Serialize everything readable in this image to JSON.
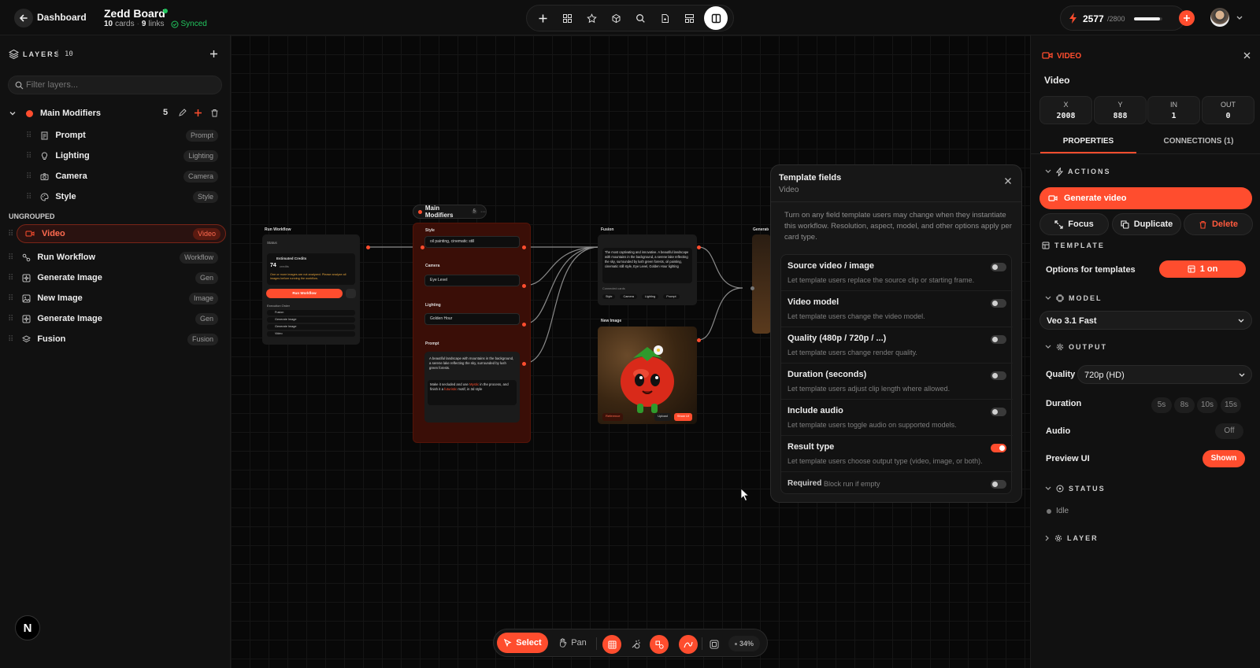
{
  "topbar": {
    "back_label": "Dashboard",
    "board_title": "Zedd Board",
    "cards_count": "10",
    "cards_label": "cards",
    "links_count": "9",
    "links_label": "links",
    "synced_label": "Synced",
    "credits_value": "2577",
    "credits_total": "/2800",
    "credits_fraction": 0.92
  },
  "layers": {
    "title": "LAYERS",
    "count": "10",
    "filter_placeholder": "Filter layers...",
    "group": {
      "name": "Main Modifiers",
      "count": "5"
    },
    "group_items": [
      {
        "label": "Prompt",
        "tag": "Prompt"
      },
      {
        "label": "Lighting",
        "tag": "Lighting"
      },
      {
        "label": "Camera",
        "tag": "Camera"
      },
      {
        "label": "Style",
        "tag": "Style"
      }
    ],
    "ungrouped_label": "UNGROUPED",
    "ungrouped_items": [
      {
        "label": "Video",
        "tag": "Video"
      },
      {
        "label": "Run Workflow",
        "tag": "Workflow"
      },
      {
        "label": "Generate Image",
        "tag": "Gen"
      },
      {
        "label": "New Image",
        "tag": "Image"
      },
      {
        "label": "Generate Image",
        "tag": "Gen"
      },
      {
        "label": "Fusion",
        "tag": "Fusion"
      }
    ]
  },
  "canvas": {
    "group_label": "Main Modifiers",
    "group_count": "5",
    "run_node": {
      "title": "Run Workflow",
      "status_label": "Status",
      "credits_label": "Estimated Credits",
      "credits_value": "74",
      "credits_unit": "credits",
      "warning": "One or more images are not analyzed. Please analyze all images before running the workflow.",
      "run_label": "Run Workflow",
      "order_label": "Execution Order",
      "order": [
        "Fusion",
        "Generate Image",
        "Generate Image",
        "Video"
      ]
    },
    "mod_node": {
      "style_label": "Style",
      "style_value": "oil painting, cinematic still",
      "camera_label": "Camera",
      "camera_value": "Eye Level",
      "lighting_label": "Lighting",
      "lighting_value": "Golden Hour",
      "prompt_label": "Prompt",
      "prompt_value": "A beautiful landscape with mountains in the background, a serene lake reflecting the sky, surrounded by lush green forests.",
      "prompt_extra_pre": "Make it secluded and use",
      "prompt_extra_hl1": "Mystic",
      "prompt_extra_mid": "in the process, and finish it a",
      "prompt_extra_hl2": "futuristic",
      "prompt_extra_post": "motif, in 3d style"
    },
    "fusion_node": {
      "title": "Fusion",
      "text": "The most captivating and innovative. A beautiful landscape with mountains in the background, a serene lake reflecting the sky, surrounded by lush green forests, oil painting, cinematic still style, Eye Level, Golden Hour lighting",
      "connected_label": "Connected cards",
      "chips": [
        "Style",
        "Camera",
        "Lighting",
        "Prompt"
      ]
    },
    "image_node": {
      "title": "New Image",
      "reference_label": "Reference",
      "upload_label": "Upload",
      "show_label": "Show UI"
    },
    "generate_node_title": "Generate"
  },
  "template_popup": {
    "title": "Template fields",
    "subtitle": "Video",
    "description": "Turn on any field template users may change when they instantiate this workflow. Resolution, aspect, model, and other options apply per card type.",
    "fields": [
      {
        "title": "Source video / image",
        "desc": "Let template users replace the source clip or starting frame.",
        "on": false
      },
      {
        "title": "Video model",
        "desc": "Let template users change the video model.",
        "on": false
      },
      {
        "title": "Quality (480p / 720p / ...)",
        "desc": "Let template users change render quality.",
        "on": false
      },
      {
        "title": "Duration (seconds)",
        "desc": "Let template users adjust clip length where allowed.",
        "on": false
      },
      {
        "title": "Include audio",
        "desc": "Let template users toggle audio on supported models.",
        "on": false
      },
      {
        "title": "Result type",
        "desc": "Let template users choose output type (video, image, or both).",
        "on": true
      }
    ],
    "required_label": "Required",
    "required_hint": "Block run if empty"
  },
  "inspector": {
    "type_label": "VIDEO",
    "name": "Video",
    "stats": [
      {
        "k": "X",
        "v": "2008"
      },
      {
        "k": "Y",
        "v": "888"
      },
      {
        "k": "IN",
        "v": "1"
      },
      {
        "k": "OUT",
        "v": "0"
      }
    ],
    "tabs": [
      "PROPERTIES",
      "CONNECTIONS (1)"
    ],
    "actions_label": "ACTIONS",
    "generate_label": "Generate video",
    "focus_label": "Focus",
    "duplicate_label": "Duplicate",
    "delete_label": "Delete",
    "template_label": "TEMPLATE",
    "options_label": "Options for templates",
    "options_value": "1 on",
    "model_label": "MODEL",
    "model_value": "Veo 3.1 Fast",
    "output_label": "OUTPUT",
    "quality_label": "Quality",
    "quality_value": "720p (HD)",
    "duration_label": "Duration",
    "durations": [
      "5s",
      "8s",
      "10s",
      "15s"
    ],
    "audio_label": "Audio",
    "audio_value": "Off",
    "preview_label": "Preview UI",
    "preview_value": "Shown",
    "status_label": "STATUS",
    "status_value": "Idle",
    "layer_label": "LAYER"
  },
  "bottombar": {
    "select_label": "Select",
    "pan_label": "Pan",
    "zoom": "34%"
  },
  "brand_logo_letter": "N",
  "colors": {
    "accent": "#ff4d2e",
    "synced": "#22c55e",
    "panel": "#111111",
    "canvas": "#080808"
  }
}
